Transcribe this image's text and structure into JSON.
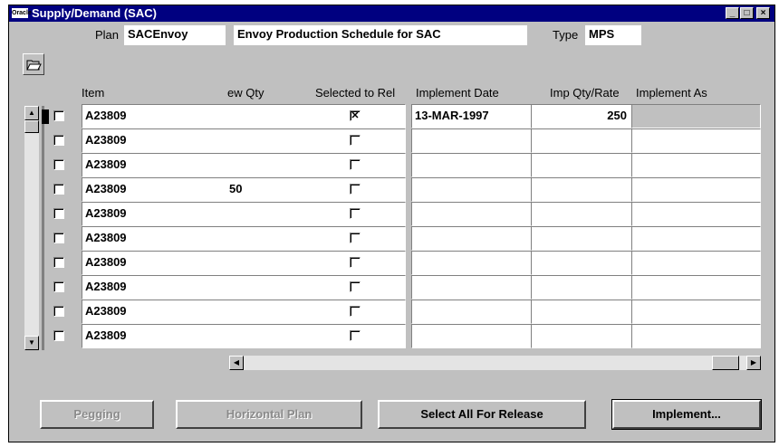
{
  "window": {
    "title": "Supply/Demand (SAC)",
    "icon_text": "Oracle",
    "controls": [
      "_",
      "□",
      "×"
    ]
  },
  "header": {
    "plan_label": "Plan",
    "plan_value": "SACEnvoy",
    "plan_desc": "Envoy Production Schedule for SAC",
    "type_label": "Type",
    "type_value": "MPS"
  },
  "toolbar": {
    "open_icon": "folder-open-icon"
  },
  "columns": {
    "item": "Item",
    "new_qty": "ew Qty",
    "selected": "Selected to Rel",
    "implement_date": "Implement Date",
    "imp_qty": "Imp Qty/Rate",
    "implement_as": "Implement As"
  },
  "rows": [
    {
      "item": "A23809",
      "new_qty": "",
      "selected": "✕",
      "implement_date": "13-MAR-1997",
      "imp_qty": "250"
    },
    {
      "item": "A23809",
      "new_qty": "",
      "selected": "",
      "implement_date": "",
      "imp_qty": ""
    },
    {
      "item": "A23809",
      "new_qty": "",
      "selected": "",
      "implement_date": "",
      "imp_qty": ""
    },
    {
      "item": "A23809",
      "new_qty": "50",
      "selected": "",
      "implement_date": "",
      "imp_qty": ""
    },
    {
      "item": "A23809",
      "new_qty": "",
      "selected": "",
      "implement_date": "",
      "imp_qty": ""
    },
    {
      "item": "A23809",
      "new_qty": "",
      "selected": "",
      "implement_date": "",
      "imp_qty": ""
    },
    {
      "item": "A23809",
      "new_qty": "",
      "selected": "",
      "implement_date": "",
      "imp_qty": ""
    },
    {
      "item": "A23809",
      "new_qty": "",
      "selected": "",
      "implement_date": "",
      "imp_qty": ""
    },
    {
      "item": "A23809",
      "new_qty": "",
      "selected": "",
      "implement_date": "",
      "imp_qty": ""
    },
    {
      "item": "A23809",
      "new_qty": "",
      "selected": "",
      "implement_date": "",
      "imp_qty": ""
    }
  ],
  "buttons": {
    "pegging": "Pegging",
    "horizontal_plan": "Horizontal Plan",
    "select_all": "Select All For Release",
    "implement": "Implement..."
  },
  "scroll_glyphs": {
    "up": "▲",
    "down": "▼",
    "left": "◀",
    "right": "▶"
  }
}
